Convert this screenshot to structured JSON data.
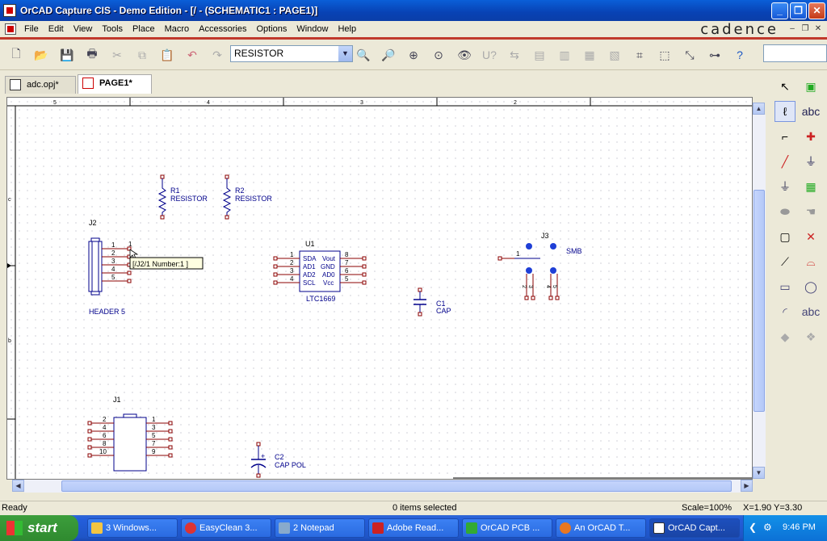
{
  "window": {
    "title": "OrCAD Capture CIS - Demo Edition - [/ - (SCHEMATIC1 : PAGE1)]"
  },
  "menu": [
    "File",
    "Edit",
    "View",
    "Tools",
    "Place",
    "Macro",
    "Accessories",
    "Options",
    "Window",
    "Help"
  ],
  "brand": "cadence",
  "toolbar": {
    "part_combo": "RESISTOR"
  },
  "tabs": [
    {
      "label": "adc.opj*"
    },
    {
      "label": "PAGE1*"
    }
  ],
  "border": {
    "top_zones": [
      "5",
      "4",
      "3",
      "2"
    ],
    "left_zones": [
      "c",
      "b"
    ]
  },
  "schematic": {
    "r1": {
      "ref": "R1",
      "value": "RESISTOR"
    },
    "r2": {
      "ref": "R2",
      "value": "RESISTOR"
    },
    "j2": {
      "ref": "J2",
      "value": "HEADER 5",
      "pins": [
        "1",
        "2",
        "3",
        "4",
        "5"
      ],
      "tooltip": "[/J2/1 Number:1 ]",
      "hover_pin": "1"
    },
    "u1": {
      "ref": "U1",
      "value": "LTC1669",
      "left_pins": [
        "1",
        "2",
        "3",
        "4"
      ],
      "right_pins": [
        "8",
        "7",
        "6",
        "5"
      ],
      "left_labels": [
        "SDA",
        "AD1",
        "AD2",
        "SCL"
      ],
      "right_labels": [
        "Vout",
        "GND",
        "AD0",
        "Vcc"
      ]
    },
    "c1": {
      "ref": "C1",
      "value": "CAP"
    },
    "j3": {
      "ref": "J3",
      "value": "SMB",
      "pins": [
        "1",
        "2",
        "3",
        "4",
        "5"
      ]
    },
    "j1": {
      "ref": "J1",
      "left_pins": [
        "2",
        "4",
        "6",
        "8",
        "10"
      ],
      "right_pins": [
        "1",
        "3",
        "5",
        "7",
        "9"
      ]
    },
    "c2": {
      "ref": "C2",
      "value": "CAP POL",
      "polarity": "+"
    }
  },
  "status": {
    "left": "Ready",
    "selected": "0 items selected",
    "scale": "Scale=100%",
    "coords": "X=1.90  Y=3.30"
  },
  "taskbar": {
    "start": "start",
    "items": [
      "3 Windows...",
      "EasyClean 3...",
      "2 Notepad",
      "Adobe Read...",
      "OrCAD PCB ...",
      "An OrCAD T...",
      "OrCAD Capt..."
    ],
    "time": "9:46 PM"
  },
  "colors": {
    "wire": "#8b0000",
    "part": "#00008b",
    "pin": "#8b0000",
    "accent": "#c0392b"
  }
}
